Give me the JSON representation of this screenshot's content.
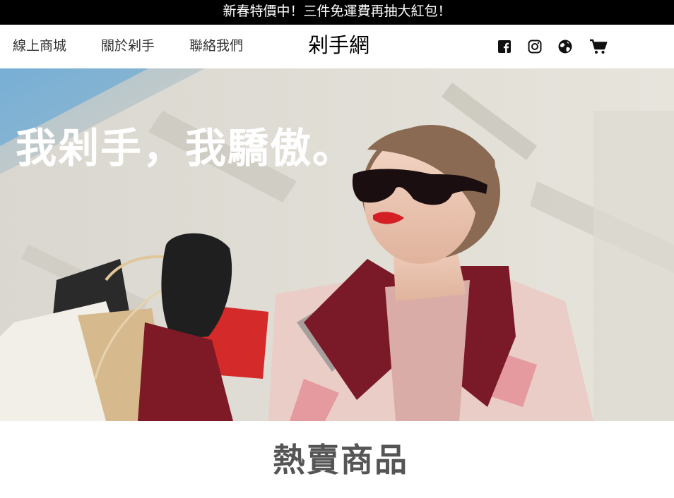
{
  "promo": {
    "text": "新春特價中！三件免運費再抽大紅包！"
  },
  "nav": {
    "links": [
      {
        "label": "線上商城"
      },
      {
        "label": "關於剁手"
      },
      {
        "label": "聯絡我們"
      }
    ],
    "brand": "剁手網",
    "icons": [
      "facebook-icon",
      "instagram-icon",
      "globe-icon",
      "cart-icon"
    ]
  },
  "hero": {
    "title": "我剁手，我驕傲。",
    "image": "woman-with-sunglasses-and-shopping-bags"
  },
  "section": {
    "title": "熱賣商品"
  },
  "colors": {
    "promo_bg": "#000000",
    "text_dark": "#333333",
    "section_title": "#555555"
  }
}
